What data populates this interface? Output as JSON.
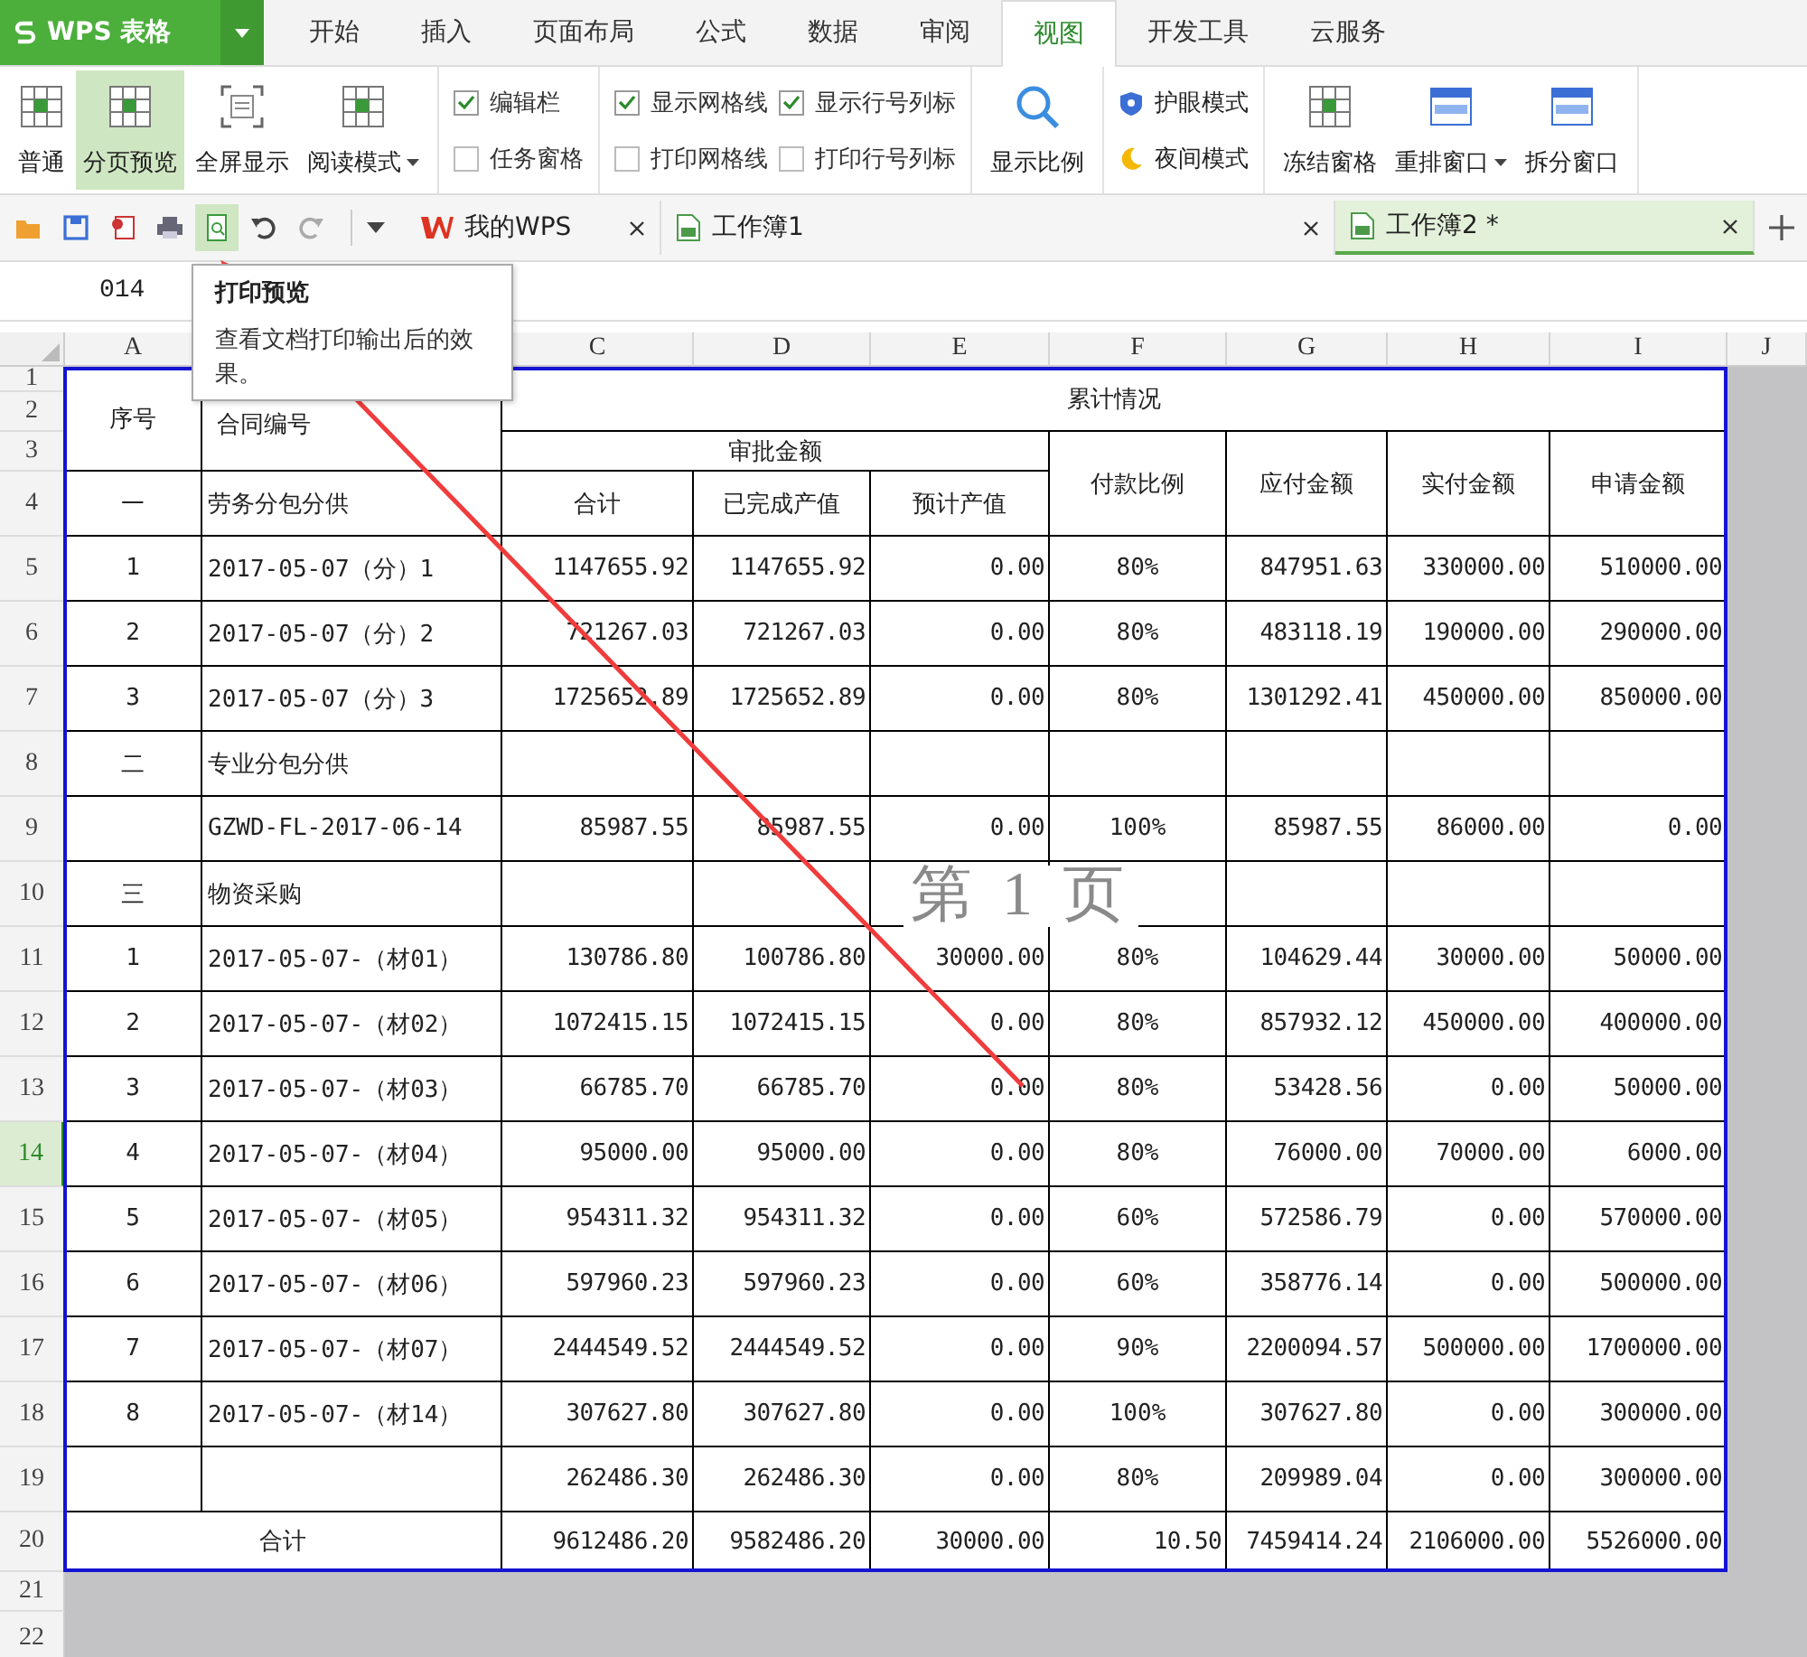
{
  "app_button": {
    "label": "WPS 表格"
  },
  "ribbon_tabs": [
    {
      "label": "开始",
      "selected": false
    },
    {
      "label": "插入",
      "selected": false
    },
    {
      "label": "页面布局",
      "selected": false
    },
    {
      "label": "公式",
      "selected": false
    },
    {
      "label": "数据",
      "selected": false
    },
    {
      "label": "审阅",
      "selected": false
    },
    {
      "label": "视图",
      "selected": true
    },
    {
      "label": "开发工具",
      "selected": false
    },
    {
      "label": "云服务",
      "selected": false
    }
  ],
  "ribbon_groups": [
    {
      "items": [
        {
          "kind": "large",
          "label": "普通",
          "selected": false,
          "dropdown": false
        },
        {
          "kind": "large",
          "label": "分页预览",
          "selected": true,
          "dropdown": false
        },
        {
          "kind": "large",
          "label": "全屏显示",
          "selected": false,
          "dropdown": false
        },
        {
          "kind": "large",
          "label": "阅读模式",
          "selected": false,
          "dropdown": true
        }
      ]
    },
    {
      "items": [
        {
          "kind": "checkbox",
          "label": "编辑栏",
          "checked": true
        },
        {
          "kind": "checkbox",
          "label": "任务窗格",
          "checked": false
        }
      ]
    },
    {
      "items": [
        {
          "kind": "checkbox",
          "label": "显示网格线",
          "checked": true
        },
        {
          "kind": "checkbox",
          "label": "打印网格线",
          "checked": false
        },
        {
          "kind": "checkbox",
          "label": "显示行号列标",
          "checked": true
        },
        {
          "kind": "checkbox",
          "label": "打印行号列标",
          "checked": false
        }
      ]
    },
    {
      "items": [
        {
          "kind": "large",
          "label": "显示比例",
          "selected": false,
          "dropdown": false
        }
      ]
    },
    {
      "items": [
        {
          "kind": "small",
          "label": "护眼模式"
        },
        {
          "kind": "small",
          "label": "夜间模式"
        }
      ]
    },
    {
      "items": [
        {
          "kind": "large",
          "label": "冻结窗格",
          "selected": false,
          "dropdown": false
        },
        {
          "kind": "large",
          "label": "重排窗口",
          "selected": false,
          "dropdown": true
        },
        {
          "kind": "large",
          "label": "拆分窗口",
          "selected": false,
          "dropdown": false
        }
      ]
    }
  ],
  "doc_tabs": [
    {
      "label": "我的WPS",
      "selected": false
    },
    {
      "label": "工作簿1",
      "selected": false
    },
    {
      "label": "工作簿2 *",
      "selected": true
    }
  ],
  "name_box": "014",
  "tooltip": {
    "title": "打印预览",
    "text": "查看文档打印输出后的效果。"
  },
  "sheet": {
    "column_headers_left": [
      "A"
    ],
    "column_headers_right": [
      "C",
      "D",
      "E",
      "F",
      "G",
      "H",
      "I",
      "J"
    ],
    "row_headers": [
      {
        "label": "1",
        "selected": false
      },
      {
        "label": "2",
        "selected": false
      },
      {
        "label": "3",
        "selected": false
      },
      {
        "label": "4",
        "selected": false
      },
      {
        "label": "5",
        "selected": false
      },
      {
        "label": "6",
        "selected": false
      },
      {
        "label": "7",
        "selected": false
      },
      {
        "label": "8",
        "selected": false
      },
      {
        "label": "9",
        "selected": false
      },
      {
        "label": "10",
        "selected": false
      },
      {
        "label": "11",
        "selected": false
      },
      {
        "label": "12",
        "selected": false
      },
      {
        "label": "13",
        "selected": false
      },
      {
        "label": "14",
        "selected": true
      },
      {
        "label": "15",
        "selected": false
      },
      {
        "label": "16",
        "selected": false
      },
      {
        "label": "17",
        "selected": false
      },
      {
        "label": "18",
        "selected": false
      },
      {
        "label": "19",
        "selected": false
      },
      {
        "label": "20",
        "selected": false
      },
      {
        "label": "21",
        "selected": false
      },
      {
        "label": "22",
        "selected": false
      }
    ],
    "page_label": "第 1 页",
    "header": {
      "seq": "序号",
      "contract": "合同编号",
      "cumulative": "累计情况",
      "approved": "审批金额",
      "approved_columns": [
        "合计",
        "已完成产值",
        "预计产值"
      ],
      "other_columns": [
        "付款比例",
        "应付金额",
        "实付金额",
        "申请金额"
      ]
    },
    "rows": [
      {
        "kind": "section",
        "cells": [
          "一",
          "劳务分包分供"
        ]
      },
      {
        "kind": "item",
        "cells": [
          "1",
          "2017-05-07（分）1",
          "1147655.92",
          "1147655.92",
          "0.00",
          "80%",
          "847951.63",
          "330000.00",
          "510000.00"
        ]
      },
      {
        "kind": "item",
        "cells": [
          "2",
          "2017-05-07（分）2",
          "721267.03",
          "721267.03",
          "0.00",
          "80%",
          "483118.19",
          "190000.00",
          "290000.00"
        ]
      },
      {
        "kind": "item",
        "cells": [
          "3",
          "2017-05-07（分）3",
          "1725652.89",
          "1725652.89",
          "0.00",
          "80%",
          "1301292.41",
          "450000.00",
          "850000.00"
        ]
      },
      {
        "kind": "section",
        "cells": [
          "二",
          "专业分包分供"
        ]
      },
      {
        "kind": "item",
        "cells": [
          null,
          "GZWD-FL-2017-06-14",
          "85987.55",
          "85987.55",
          "0.00",
          "100%",
          "85987.55",
          "86000.00",
          "0.00"
        ]
      },
      {
        "kind": "section",
        "cells": [
          "三",
          "物资采购"
        ]
      },
      {
        "kind": "item",
        "cells": [
          "1",
          "2017-05-07-（材01）",
          "130786.80",
          "100786.80",
          "30000.00",
          "80%",
          "104629.44",
          "30000.00",
          "50000.00"
        ]
      },
      {
        "kind": "item",
        "cells": [
          "2",
          "2017-05-07-（材02）",
          "1072415.15",
          "1072415.15",
          "0.00",
          "80%",
          "857932.12",
          "450000.00",
          "400000.00"
        ]
      },
      {
        "kind": "item",
        "cells": [
          "3",
          "2017-05-07-（材03）",
          "66785.70",
          "66785.70",
          "0.00",
          "80%",
          "53428.56",
          "0.00",
          "50000.00"
        ]
      },
      {
        "kind": "item",
        "cells": [
          "4",
          "2017-05-07-（材04）",
          "95000.00",
          "95000.00",
          "0.00",
          "80%",
          "76000.00",
          "70000.00",
          "6000.00"
        ]
      },
      {
        "kind": "item",
        "cells": [
          "5",
          "2017-05-07-（材05）",
          "954311.32",
          "954311.32",
          "0.00",
          "60%",
          "572586.79",
          "0.00",
          "570000.00"
        ]
      },
      {
        "kind": "item",
        "cells": [
          "6",
          "2017-05-07-（材06）",
          "597960.23",
          "597960.23",
          "0.00",
          "60%",
          "358776.14",
          "0.00",
          "500000.00"
        ]
      },
      {
        "kind": "item",
        "cells": [
          "7",
          "2017-05-07-（材07）",
          "2444549.52",
          "2444549.52",
          "0.00",
          "90%",
          "2200094.57",
          "500000.00",
          "1700000.00"
        ]
      },
      {
        "kind": "item",
        "cells": [
          "8",
          "2017-05-07-（材14）",
          "307627.80",
          "307627.80",
          "0.00",
          "100%",
          "307627.80",
          "0.00",
          "300000.00"
        ]
      },
      {
        "kind": "item",
        "cells": [
          null,
          null,
          "262486.30",
          "262486.30",
          "0.00",
          "80%",
          "209989.04",
          "0.00",
          "300000.00"
        ]
      },
      {
        "kind": "total",
        "cells": [
          null,
          "合计",
          "9612486.20",
          "9582486.20",
          "30000.00",
          "10.50",
          "7459414.24",
          "2106000.00",
          "5526000.00"
        ]
      }
    ]
  }
}
